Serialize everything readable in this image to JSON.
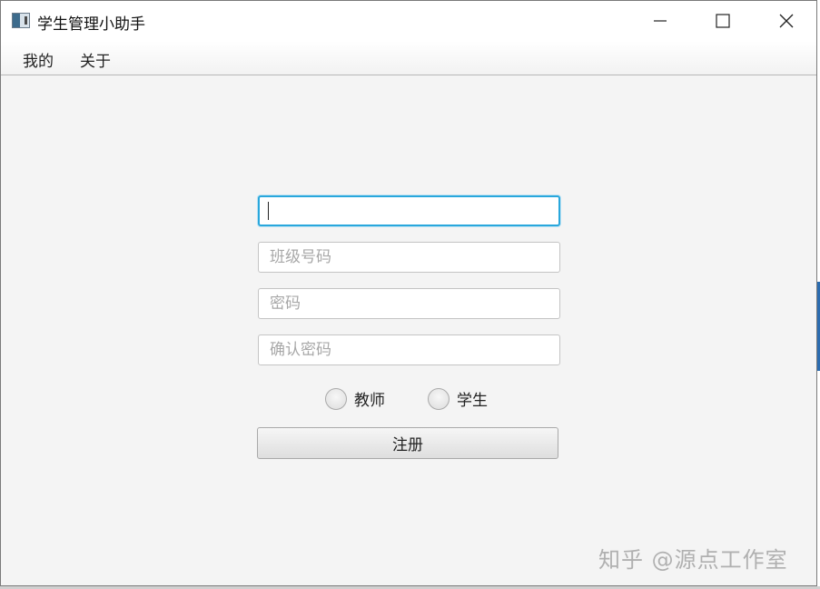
{
  "window": {
    "title": "学生管理小助手",
    "icon": "app-window-icon",
    "controls": [
      "minimize-icon",
      "maximize-icon",
      "close-icon"
    ]
  },
  "menubar": {
    "items": [
      {
        "label": "我的"
      },
      {
        "label": "关于"
      }
    ]
  },
  "form": {
    "name_field": {
      "value": "",
      "placeholder": ""
    },
    "class_field": {
      "value": "",
      "placeholder": "班级号码"
    },
    "password_field": {
      "value": "",
      "placeholder": "密码"
    },
    "confirm_field": {
      "value": "",
      "placeholder": "确认密码"
    },
    "roles": [
      {
        "label": "教师",
        "selected": false
      },
      {
        "label": "学生",
        "selected": false
      }
    ],
    "submit_label": "注册"
  },
  "watermark": "知乎 @源点工作室",
  "colors": {
    "focus_border": "#29a7dc",
    "background": "#f4f4f4"
  }
}
